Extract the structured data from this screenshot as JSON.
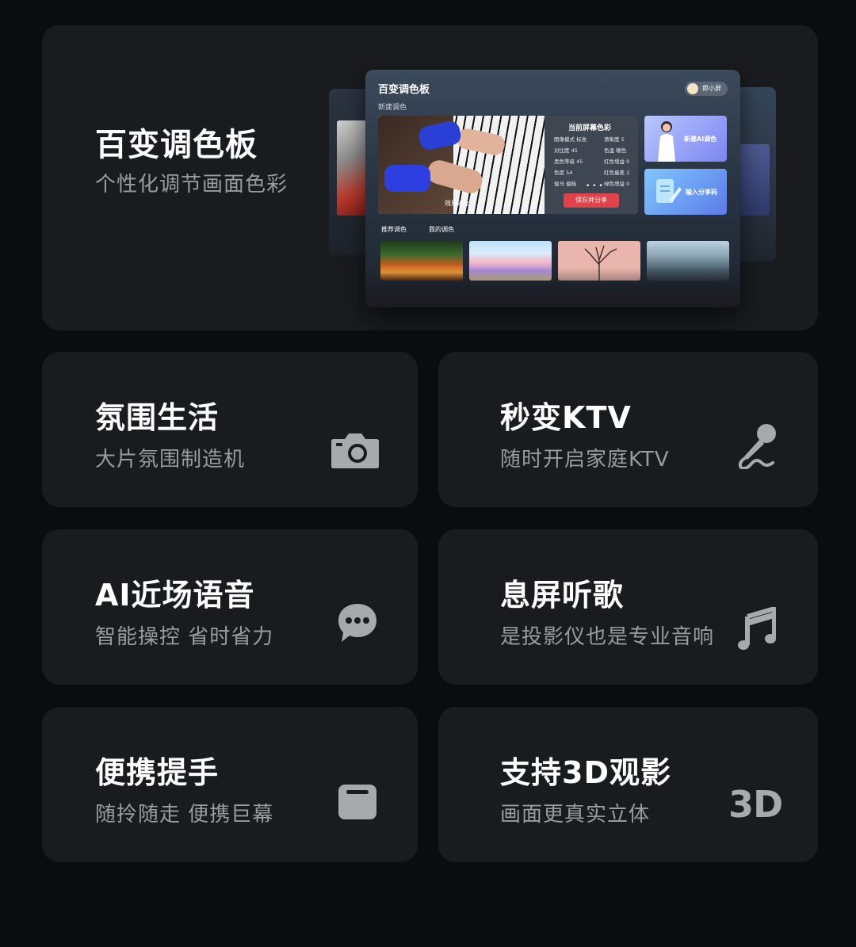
{
  "hero": {
    "title": "百变调色板",
    "subtitle": "个性化调节画面色彩",
    "mockup": {
      "title": "百变调色板",
      "new_label": "新建调色",
      "user": "郎小屏",
      "compare_label": "效果对比",
      "panel_title": "当前屏幕色彩",
      "stats": [
        "图像模式 标准",
        "清晰度 5",
        "对比度 45",
        "色温 暖色",
        "黑色等级 45",
        "红色增益 0",
        "色度 54",
        "红色偏差 2",
        "伽马 偏暗",
        "绿色增益 0"
      ],
      "more": "• • •",
      "save_label": "保存并分享",
      "tile_ai": "新建AI调色",
      "tile_code": "输入分享码",
      "tabs": [
        "推荐调色",
        "我的调色"
      ]
    }
  },
  "features": [
    {
      "title": "氛围生活",
      "subtitle": "大片氛围制造机",
      "icon": "camera-icon"
    },
    {
      "title": "秒变KTV",
      "subtitle": "随时开启家庭KTV",
      "icon": "microphone-icon"
    },
    {
      "title": "AI近场语音",
      "subtitle": "智能操控 省时省力",
      "icon": "chat-bubble-icon"
    },
    {
      "title": "息屏听歌",
      "subtitle": "是投影仪也是专业音响",
      "icon": "music-note-icon"
    },
    {
      "title": "便携提手",
      "subtitle": "随拎随走 便携巨幕",
      "icon": "handle-icon"
    },
    {
      "title": "支持3D观影",
      "subtitle": "画面更真实立体",
      "icon": "3d-icon",
      "icon_text": "3D"
    }
  ],
  "colors": {
    "background": "#0b0c10",
    "card": "#1a1b1f",
    "subtitle": "#9a9ba0",
    "icon": "#a8a9ad",
    "accent_save": "#e2424a"
  }
}
